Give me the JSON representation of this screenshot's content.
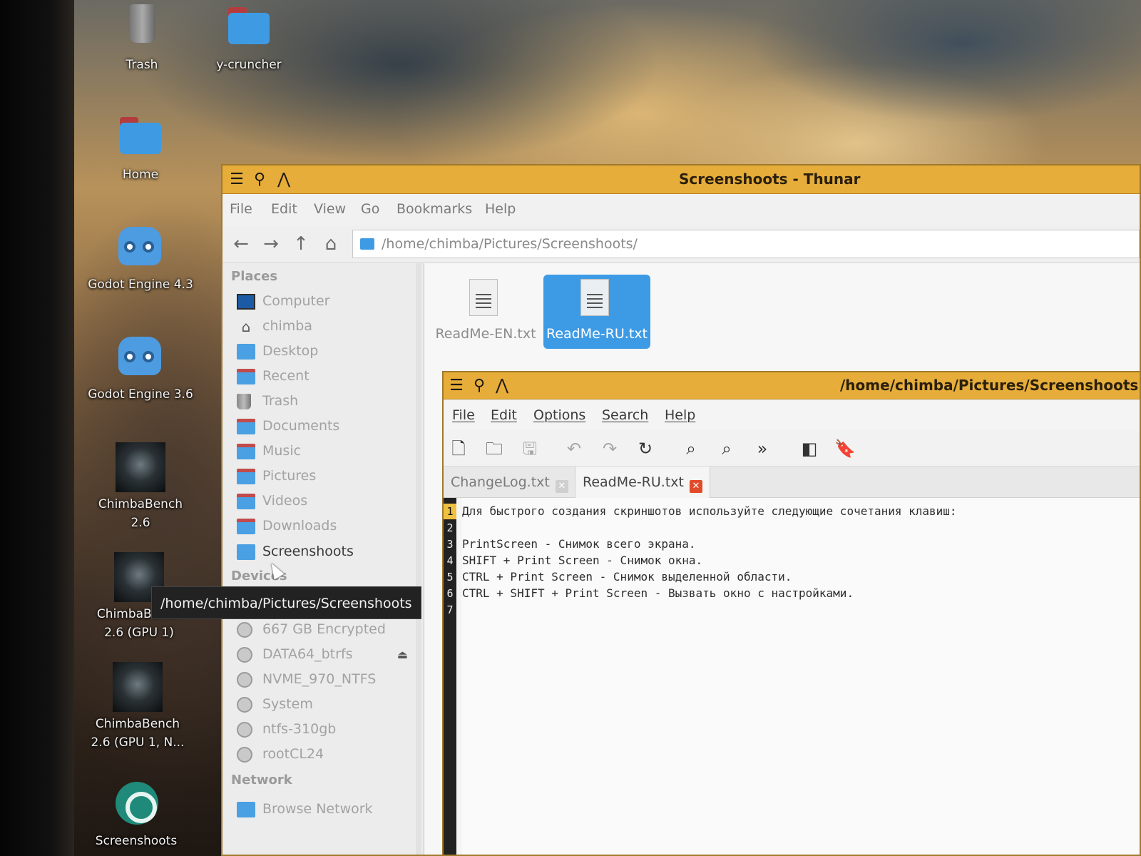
{
  "desktop": {
    "icons": [
      {
        "label": "Trash"
      },
      {
        "label": "y-cruncher"
      },
      {
        "label": "Home"
      },
      {
        "label": "Godot Engine 4.3"
      },
      {
        "label": "Godot Engine 3.6"
      },
      {
        "label": "ChimbaBench 2.6"
      },
      {
        "label": "ChimbaBench 2.6 (GPU 1)"
      },
      {
        "label": "ChimbaBench 2.6 (GPU 1, N..."
      },
      {
        "label": "Screenshoots"
      }
    ]
  },
  "thunar": {
    "title": "Screenshoots - Thunar",
    "menu": [
      "File",
      "Edit",
      "View",
      "Go",
      "Bookmarks",
      "Help"
    ],
    "location": "/home/chimba/Pictures/Screenshoots/",
    "sidebar": {
      "places_header": "Places",
      "places": [
        "Computer",
        "chimba",
        "Desktop",
        "Recent",
        "Trash",
        "Documents",
        "Music",
        "Pictures",
        "Videos",
        "Downloads",
        "Screenshoots"
      ],
      "devices_header": "Devices",
      "devices": [
        "667 GB Encrypted",
        "DATA64_btrfs",
        "NVME_970_NTFS",
        "System",
        "ntfs-310gb",
        "rootCL24"
      ],
      "network_header": "Network",
      "network": [
        "Browse Network"
      ]
    },
    "files": [
      {
        "name": "ReadMe-EN.txt",
        "selected": false
      },
      {
        "name": "ReadMe-RU.txt",
        "selected": true
      }
    ],
    "tooltip": "/home/chimba/Pictures/Screenshoots"
  },
  "editor": {
    "title": "/home/chimba/Pictures/Screenshoots",
    "menu": [
      "File",
      "Edit",
      "Options",
      "Search",
      "Help"
    ],
    "tabs": [
      "ChangeLog.txt",
      "ReadMe-RU.txt"
    ],
    "active_tab": "ReadMe-RU.txt",
    "line_numbers": [
      "1",
      "2",
      "3",
      "4",
      "5",
      "6",
      "7"
    ],
    "lines": [
      "Для быстрого создания скриншотов используйте следующие сочетания клавиш:",
      "",
      "PrintScreen - Снимок всего экрана.",
      "SHIFT + Print Screen - Снимок окна.",
      "CTRL + Print Screen - Снимок выделенной области.",
      "CTRL + SHIFT + Print Screen - Вызвать окно с настройками.",
      ""
    ]
  },
  "colors": {
    "titlebar": "#e6ad3a",
    "selection": "#3d9be6",
    "folder": "#3e9be3",
    "tab_close_active": "#e24b2a"
  }
}
